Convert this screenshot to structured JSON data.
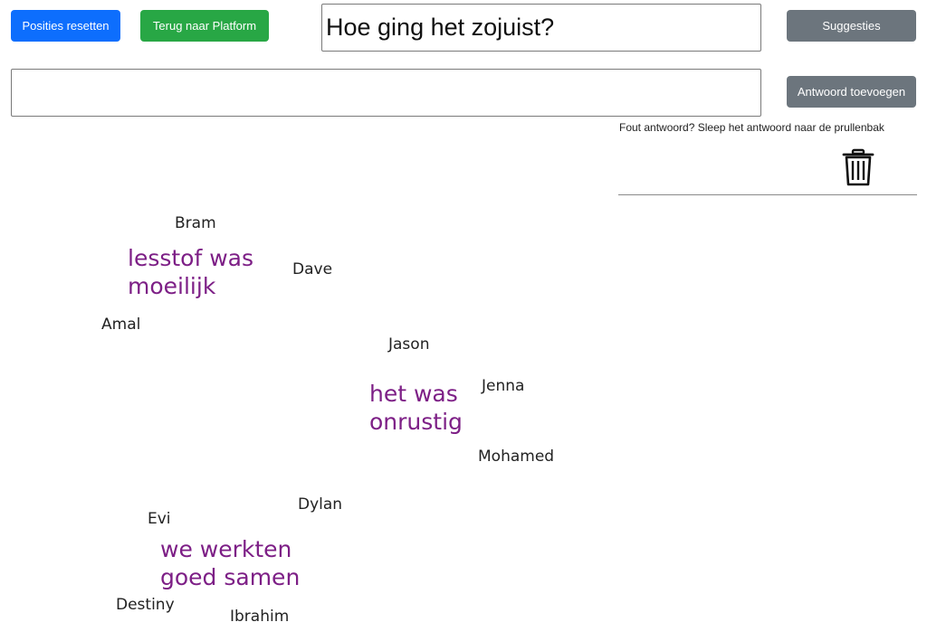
{
  "toolbar": {
    "reset_label": "Posities resetten",
    "platform_label": "Terug naar Platform",
    "suggest_label": "Suggesties",
    "add_label": "Antwoord toevoegen"
  },
  "question": {
    "value": "Hoe ging het zojuist?"
  },
  "answer_input": {
    "value": ""
  },
  "trash": {
    "hint": "Fout antwoord? Sleep het antwoord naar de prullenbak"
  },
  "board": {
    "names": [
      "Bram",
      "Dave",
      "Amal",
      "Jason",
      "Jenna",
      "Mohamed",
      "Dylan",
      "Evi",
      "Destiny",
      "Ibrahim"
    ],
    "answers": [
      {
        "line1": "lesstof was",
        "line2": "moeilijk"
      },
      {
        "line1": "het was",
        "line2": "onrustig"
      },
      {
        "line1": "we werkten",
        "line2": "goed samen"
      }
    ]
  },
  "colors": {
    "answer": "#7d1f86",
    "primary": "#0d6efd",
    "success": "#28a745",
    "secondary": "#6c757d"
  }
}
